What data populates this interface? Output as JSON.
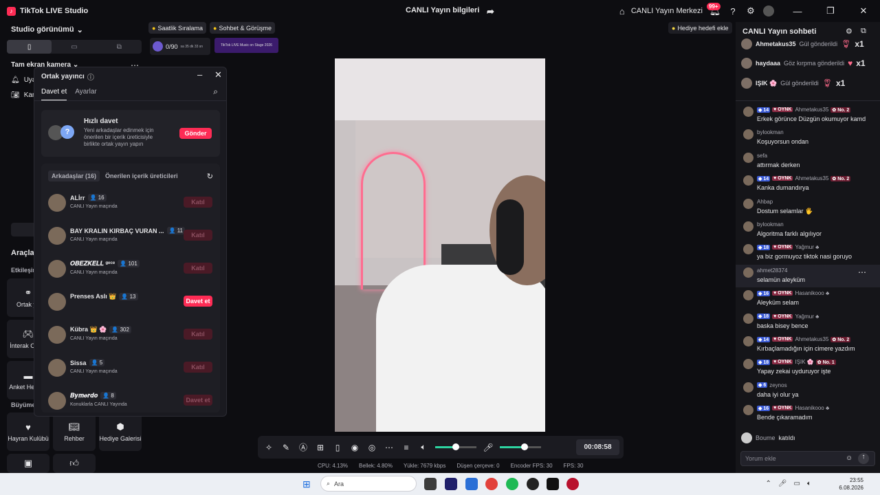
{
  "app": {
    "title": "TikTok LIVE Studio",
    "center_title": "CANLI Yayın bilgileri",
    "center_label": "CANLI Yayın Merkezi",
    "notif_count": "99+"
  },
  "left": {
    "studio_view": "Studio görünümü",
    "section": "Tam ekran kamera",
    "rows": [
      "Uya",
      "Kam"
    ],
    "tools": "Araçlar",
    "etk": "Etkileşim",
    "grow": "Büyüme",
    "tiles": [
      {
        "label": "Ortak ya",
        "icon": "link-icon"
      },
      {
        "label": "İnterak Oyunl",
        "icon": "game-icon"
      },
      {
        "label": "Anket Hediyel",
        "icon": "poll-icon"
      },
      {
        "label": "Hayran Kulübü",
        "icon": "heart-icon"
      },
      {
        "label": "Rehber",
        "icon": "book-icon"
      },
      {
        "label": "Hediye Galerisi",
        "icon": "gift-icon"
      }
    ]
  },
  "popup": {
    "title": "Ortak yayıncı",
    "tab_invite": "Davet et",
    "tab_settings": "Ayarlar",
    "quick": {
      "title": "Hızlı davet",
      "desc": "Yeni arkadaşlar edinmek için önerilen bir içerik üreticisiyle birlikte ortak yayın yapın",
      "button": "Gönder"
    },
    "friends_tab": "Arkadaşlar (16)",
    "suggested_tab": "Önerilen içerik üreticileri",
    "friends": [
      {
        "name": "ALİrr",
        "count": "16",
        "sub": "CANLI Yayın maçında",
        "button": "Katıl",
        "active": false
      },
      {
        "name": "BAY KRALIN KIRBAÇ VURAN ...",
        "count": "11",
        "sub": "CANLI Yayın maçında",
        "button": "Katıl",
        "active": false
      },
      {
        "name": "𝑶𝑩𝑬𝒁𝑲𝑬𝑳𝑳 ᵍᵉᶜᵉ",
        "count": "101",
        "sub": "CANLI Yayın maçında",
        "button": "Katıl",
        "active": false
      },
      {
        "name": "Prenses Aslı 👑",
        "count": "13",
        "sub": "",
        "button": "Davet et",
        "active": true
      },
      {
        "name": "Kübra 👑 🌸",
        "count": "302",
        "sub": "CANLI Yayın maçında",
        "button": "Katıl",
        "active": false
      },
      {
        "name": "Sissa",
        "count": "5",
        "sub": "CANLI Yayın maçında",
        "button": "Katıl",
        "active": false
      },
      {
        "name": "𝑩𝒚𝒎𝒆𝒓𝒅𝒐",
        "count": "8",
        "sub": "Konuklarla CANLI Yayında",
        "button": "Davet et",
        "active": false
      }
    ]
  },
  "stage": {
    "pill1": "Saatlik Sıralama",
    "pill2": "Sohbet & Görüşme",
    "goal": "Hediye hedefi ekle",
    "sub_count": "0/90",
    "sub_timer": "sa 35 dk 33 sn",
    "banner": "TikTok LIVE Music on Stage 2026"
  },
  "controls": {
    "timer": "00:08:58",
    "vol_level": 0.5,
    "mic_level": 0.6
  },
  "status": [
    "CPU: 4.13%",
    "Bellek: 4.80%",
    "Yükle: 7679 kbps",
    "Düşen çerçeve: 0",
    "Encoder FPS: 30",
    "FPS: 30"
  ],
  "chat": {
    "title": "CANLI Yayın sohbeti",
    "placeholder": "Yorum ekle",
    "gifts": [
      {
        "user": "Ahmetakus35",
        "text": "Gül gönderildi",
        "x": "x1"
      },
      {
        "user": "haydaaa",
        "text": "Göz kırpma gönderildi",
        "x": "x1"
      },
      {
        "user": "IŞIK 🌸",
        "text": "Gül gönderildi",
        "x": "x1"
      }
    ],
    "messages": [
      {
        "lvl": "14",
        "fan": "OYNK",
        "user": "Ahmetakus35",
        "rank": "No. 2",
        "text": "Erkek görünce Düzgün okumuyor kamd"
      },
      {
        "lvl": "",
        "fan": "",
        "user": "bylookman",
        "rank": "",
        "text": "Koşuyorsun ondan"
      },
      {
        "lvl": "",
        "fan": "",
        "user": "sefa",
        "rank": "",
        "text": "attırmak derken"
      },
      {
        "lvl": "14",
        "fan": "OYNK",
        "user": "Ahmetakus35",
        "rank": "No. 2",
        "text": "Kanka dumandırya"
      },
      {
        "lvl": "",
        "fan": "",
        "user": "Ahbap",
        "rank": "",
        "text": "Dostum selamlar 🖐"
      },
      {
        "lvl": "",
        "fan": "",
        "user": "bylookman",
        "rank": "",
        "text": "Algoritma farklı algılıyor"
      },
      {
        "lvl": "18",
        "fan": "OYNK",
        "user": "Yağmur ♣",
        "rank": "",
        "text": "ya biz gormuyoz tiktok nasi goruyo"
      },
      {
        "lvl": "",
        "fan": "",
        "user": "ahmet28374",
        "rank": "",
        "text": "selamün aleyküm"
      },
      {
        "lvl": "16",
        "fan": "OYNK",
        "user": "Hasanikooo ♣",
        "rank": "",
        "text": "Aleyküm selam"
      },
      {
        "lvl": "18",
        "fan": "OYNK",
        "user": "Yağmur ♣",
        "rank": "",
        "text": "baska bisey bence"
      },
      {
        "lvl": "14",
        "fan": "OYNK",
        "user": "Ahmetakus35",
        "rank": "No. 2",
        "text": "Kırbaçlamadığın için cimere yazdım"
      },
      {
        "lvl": "18",
        "fan": "OYNK",
        "user": "IŞIK 🌸",
        "rank": "No. 1",
        "text": "Yapay zekai uyduruyor işte"
      },
      {
        "lvl": "6",
        "fan": "",
        "user": "zeynos",
        "rank": "",
        "text": "daha iyi olur ya"
      },
      {
        "lvl": "16",
        "fan": "OYNK",
        "user": "Hasanikooo ♣",
        "rank": "",
        "text": "Bende çıkaramadım"
      }
    ],
    "joined": {
      "user": "Boume",
      "text": "katıldı"
    }
  },
  "taskbar": {
    "search": "Ara",
    "time": "23:55",
    "date": "6.08.2026"
  }
}
